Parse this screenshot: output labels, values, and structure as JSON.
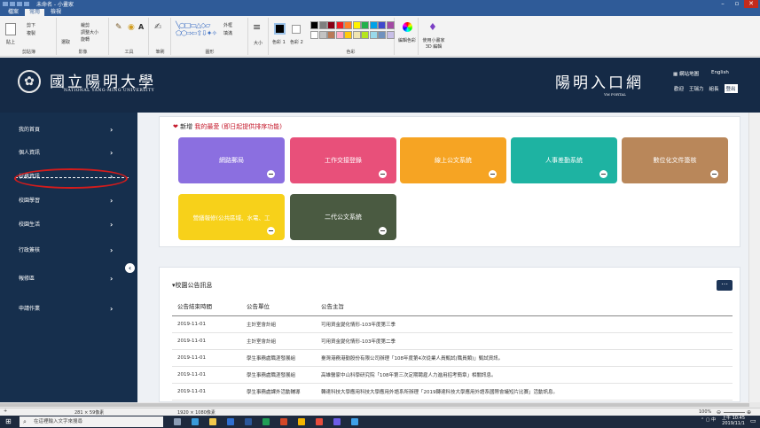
{
  "window": {
    "title": "未命名 - 小畫家"
  },
  "menubar": {
    "items": [
      "檔案",
      "常用",
      "檢視"
    ]
  },
  "ribbon": {
    "groups": [
      "剪貼簿",
      "影像",
      "工具",
      "筆刷",
      "圖形",
      "大小",
      "色彩 1",
      "色彩 2",
      "色彩",
      "使用小畫家 3D 編輯"
    ],
    "labels": {
      "paste": "貼上",
      "cut": "剪下",
      "copy": "複製",
      "select": "選取",
      "crop": "裁剪",
      "resize": "調整大小",
      "rotate": "旋轉",
      "outline": "外框",
      "fill": "填滿",
      "edit_colors": "編輯色彩"
    },
    "palette": [
      "#000000",
      "#7f7f7f",
      "#880015",
      "#ed1c24",
      "#ff7f27",
      "#fff200",
      "#22b14c",
      "#00a2e8",
      "#3f48cc",
      "#a349a4",
      "#ffffff",
      "#c3c3c3",
      "#b97a57",
      "#ffaec9",
      "#ffc90e",
      "#efe4b0",
      "#b5e61d",
      "#99d9ea",
      "#7092be",
      "#c8bfe7"
    ]
  },
  "header": {
    "seal_glyph": "✿",
    "university_name": "國立陽明大學",
    "university_en": "NATIONAL YANG-MING UNIVERSITY",
    "portal_name": "陽明入口網",
    "portal_en": "YM PORTAL",
    "sitemap": "網站地圖",
    "english": "English",
    "welcome": "歡迎",
    "user": "王瑞力",
    "profile": "組長",
    "logout": "登出"
  },
  "sidebar": {
    "items": [
      {
        "label": "我的首頁"
      },
      {
        "label": "個人資訊"
      },
      {
        "label": "校務資訊"
      },
      {
        "label": "校園學習"
      },
      {
        "label": "校園生活"
      },
      {
        "label": "行政簽核"
      },
      {
        "label": "報修區"
      },
      {
        "label": "申請作業"
      }
    ],
    "collapse_glyph": "‹"
  },
  "favorites": {
    "title_prefix": "新增",
    "title_main": "我的最愛",
    "title_note": "(即日起提供排序功能)",
    "tiles": [
      {
        "label": "網路郵局",
        "color": "#8b6fe0"
      },
      {
        "label": "工作交接登錄",
        "color": "#e8507a"
      },
      {
        "label": "線上公文系統",
        "color": "#f6a423"
      },
      {
        "label": "人事差勤系統",
        "color": "#1eb3a2"
      },
      {
        "label": "數位化文件簽核",
        "color": "#b9875a"
      },
      {
        "label": "營繕報修(公共區域、水電、工",
        "color": "#f7d11a"
      },
      {
        "label": "二代公文系統",
        "color": "#4a5a41"
      }
    ]
  },
  "news": {
    "title": "校園公告訊息",
    "more": "⋯",
    "columns": [
      "公告結束時間",
      "公告單位",
      "公告主旨"
    ],
    "rows": [
      [
        "2019-11-01",
        "主計室會計組",
        "可用資金變化情形-103年度第三季"
      ],
      [
        "2019-11-01",
        "主計室會計組",
        "可用資金變化情形-103年度第二季"
      ],
      [
        "2019-11-01",
        "學生事務處職涯發展組",
        "臺灣港務港勤股份有限公司辦理「108年度第4次從業人員甄試(職員類)」甄試資訊。"
      ],
      [
        "2019-11-01",
        "學生事務處職涯發展組",
        "高雄醫家中山科學研究院「108年第三次定期聘雇人力進用招考簡章」相關訊息。"
      ],
      [
        "2019-11-01",
        "學生事務處課外活動輔導",
        "轉達科技大學應用科技大學應用外語系所辦理「2019轉達科技大學應用外語系國際會議短片比賽」活動訊息。"
      ]
    ]
  },
  "statusbar": {
    "coords": "281 × 59像素",
    "size": "1920 × 1080像素",
    "zoom": "100%"
  },
  "taskbar": {
    "search_placeholder": "在這裡輸入文字來搜尋",
    "time": "上午 10:45",
    "date": "2019/11/1"
  }
}
